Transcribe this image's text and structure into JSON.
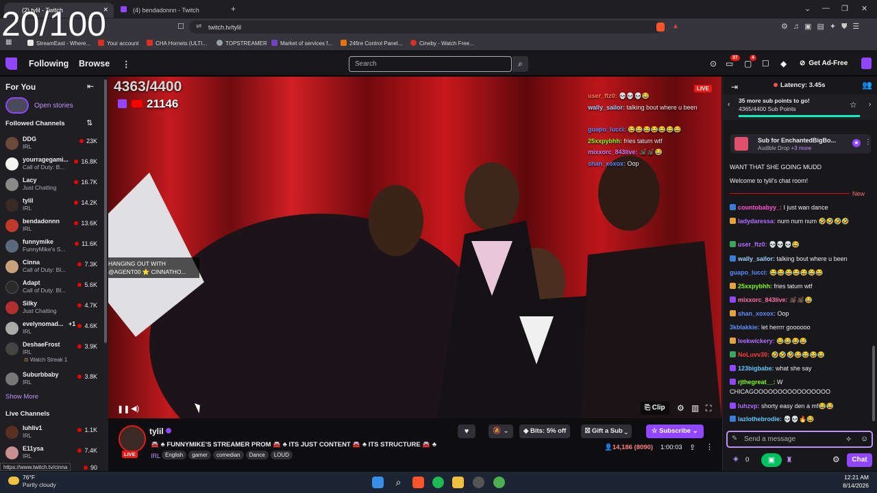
{
  "overlay_counter": "20/100",
  "browser": {
    "tabs": [
      {
        "label": "(2) tylil - Twitch"
      },
      {
        "label": "(4) bendadonnn - Twitch"
      }
    ],
    "new_tab_symbol": "+",
    "url": "twitch.tv/tylil",
    "bookmarks": [
      {
        "label": "StreamEast - Where...",
        "color": "#e8e8e8"
      },
      {
        "label": "Your account",
        "color": "#d93025"
      },
      {
        "label": "CHA Hornets (ULTI...",
        "color": "#d93025"
      },
      {
        "label": "TOPSTREAMER",
        "color": "#9aa0a6"
      },
      {
        "label": "Market of services f...",
        "color": "#6f42c1"
      },
      {
        "label": "24fire Control Panel...",
        "color": "#e8710a"
      },
      {
        "label": "Cineby - Watch Free...",
        "color": "#d93025"
      }
    ]
  },
  "twitch_nav": {
    "following": "Following",
    "browse": "Browse",
    "more": "⋮",
    "search_placeholder": "Search",
    "notif_count_1": "37",
    "notif_count_2": "4",
    "get_ad_free": "Get Ad-Free"
  },
  "sidebar": {
    "for_you": "For You",
    "open_stories": "Open stories",
    "followed_channels": "Followed Channels",
    "channels": [
      {
        "name": "DDG",
        "category": "IRL",
        "viewers": "23K",
        "color": "#6b4a3a"
      },
      {
        "name": "yourragegami...",
        "category": "Call of Duty: B...",
        "viewers": "16.8K",
        "color": "#f4f4f4"
      },
      {
        "name": "Lacy",
        "category": "Just Chatting",
        "viewers": "16.7K",
        "color": "#8a8a8a"
      },
      {
        "name": "tylil",
        "category": "IRL",
        "viewers": "14.2K",
        "color": "#3b2a24"
      },
      {
        "name": "bendadonnn",
        "category": "IRL",
        "viewers": "13.6K",
        "color": "#c0392b"
      },
      {
        "name": "funnymike",
        "category": "FunnyMike's S...",
        "viewers": "11.6K",
        "color": "#5a6a7a"
      },
      {
        "name": "Cinna",
        "category": "Call of Duty: Bl...",
        "viewers": "7.3K",
        "color": "#c9a27a"
      },
      {
        "name": "Adapt",
        "category": "Call of Duty: Bl...",
        "viewers": "5.6K",
        "color": "#2a2a2a"
      },
      {
        "name": "Silky",
        "category": "Just Chatting",
        "viewers": "4.7K",
        "color": "#b03030"
      },
      {
        "name": "evelynomad...",
        "extra": "+1",
        "category": "IRL",
        "viewers": "4.6K",
        "color": "#aaa"
      },
      {
        "name": "DeshaeFrost",
        "category": "IRL",
        "sub": "Watch Streak 1",
        "viewers": "3.9K",
        "color": "#444"
      },
      {
        "name": "Suburbbaby",
        "category": "IRL",
        "viewers": "3.8K",
        "color": "#777"
      }
    ],
    "show_more": "Show More",
    "live_channels": "Live Channels",
    "live": [
      {
        "name": "luhliv1",
        "category": "IRL",
        "viewers": "1.1K",
        "color": "#5a3020"
      },
      {
        "name": "E11ysa",
        "category": "IRL",
        "viewers": "7.4K",
        "color": "#c89090"
      },
      {
        "name": "",
        "category": "",
        "viewers": "90",
        "color": "#555"
      }
    ],
    "status_url": "https://www.twitch.tv/cinna"
  },
  "player": {
    "sub_goal_overlay": "4363/4400",
    "overlay_count": "21146",
    "live_label": "LIVE",
    "caption_line1": "HANGING OUT WITH",
    "caption_line2": "@AGENT00 ⭐ CINNATHO...",
    "clip_label": "Clip",
    "overlay_chat": [
      {
        "user": "user_ftz0:",
        "text": "💀💀💀😂",
        "color": "#ff7f50"
      },
      {
        "user": "wally_sailor:",
        "text": "talking bout where u been",
        "color": "#9ad0ff"
      },
      {
        "user": "guapo_lucci:",
        "text": "😂😂😂😂😂😂😂",
        "color": "#5b8cff"
      },
      {
        "user": "25xxpybhh:",
        "text": "fries tatum wtf",
        "color": "#7cfc00"
      },
      {
        "user": "mixxorc_843live:",
        "text": "👏🏿👏🏿😂",
        "color": "#c084fc"
      },
      {
        "user": "shan_xoxox:",
        "text": "Oop",
        "color": "#5b8cff"
      }
    ]
  },
  "stream_info": {
    "streamer": "tylil",
    "title": "🚘 ♣ FUNNYMIKE'S STREAMER PROM 🚘 ♣ ITS JUST CONTENT 🚘 ♣ ITS STRUCTURE 🚘 ♣",
    "category": "IRL",
    "tags": [
      "English",
      "gamer",
      "comedian",
      "Dance",
      "LOUD"
    ],
    "live_label": "LIVE",
    "bits_label": "Bits: 5% off",
    "gift_label": "Gift a Sub",
    "subscribe_label": "Subscribe",
    "viewers": "14,186 (8090)",
    "uptime": "1:00:03"
  },
  "chat": {
    "latency": "Latency: 3.45s",
    "goal_text": "35 more sub points to go!",
    "goal_progress": "4365/4400 Sub Points",
    "goal_fraction": 0.992,
    "drop_title": "Sub for EnchantedBigBo...",
    "drop_sub": "Audible Drop",
    "drop_more": "+3 more",
    "pre_line": "WANT THAT SHE GOING MUDD",
    "welcome": "Welcome to tylil's chat room!",
    "new_label": "New",
    "messages": [
      {
        "user": "countobabyy_:",
        "text": "I just wan dance",
        "color": "#ff4fd8",
        "badge": "#3a7bd5"
      },
      {
        "user": "ladydaressa:",
        "text": "num num num 🤣🤣🤣🤣",
        "color": "#b36cff",
        "badge": "#e6a23c"
      },
      {
        "user": "user_ftz0:",
        "text": "💀💀💀😂",
        "color": "#b36cff",
        "badge": "#3aa55d"
      },
      {
        "user": "wally_sailor:",
        "text": "talking bout where u been",
        "color": "#9ad0ff",
        "badge": "#3a7bd5"
      },
      {
        "user": "guapo_lucci:",
        "text": "😂😂😂😂😂😂😂",
        "color": "#5b8cff",
        "badge": ""
      },
      {
        "user": "25xxpybhh:",
        "text": "fries tatum wtf",
        "color": "#7cfc00",
        "badge": "#e6a23c"
      },
      {
        "user": "mixxorc_843live:",
        "text": "👏🏿👏🏿😂",
        "color": "#ff6ea8",
        "badge": "#9146ff"
      },
      {
        "user": "shan_xoxox:",
        "text": "Oop",
        "color": "#5b8cff",
        "badge": "#e6a23c"
      },
      {
        "user": "3kblakkie:",
        "text": "let herrrr goooooo",
        "color": "#5b8cff",
        "badge": ""
      },
      {
        "user": "leekwickery:",
        "text": "😂😂😂😂",
        "color": "#b36cff",
        "badge": "#e6a23c"
      },
      {
        "user": "NoLuvv30:",
        "text": "🤣🤣🤣😂😂😂😂",
        "color": "#ff3b3b",
        "badge": "#3aa55d"
      },
      {
        "user": "123bigbabe:",
        "text": "what she say",
        "color": "#5bc8ff",
        "badge": "#9146ff"
      },
      {
        "user": "rjthegreat__:",
        "text": "W",
        "color": "#7cfc00",
        "badge": "#9146ff"
      },
      {
        "user": "",
        "text": "CHICAGOOOOOOOOOOOOOOOO",
        "color": "",
        "badge": ""
      },
      {
        "user": "luhzvp:",
        "text": "shorty easy den a mf😂😂",
        "color": "#b36cff",
        "badge": "#9146ff"
      },
      {
        "user": "lazlothebrodie:",
        "text": "💀💀🔥😂",
        "color": "#5bc8ff",
        "badge": "#3a7bd5"
      }
    ],
    "send_placeholder": "Send a message",
    "points": "0",
    "chat_button": "Chat"
  },
  "taskbar": {
    "temperature": "76°F",
    "weather": "Partly cloudy",
    "time": "12:21 AM",
    "date": "8/14/2026"
  }
}
